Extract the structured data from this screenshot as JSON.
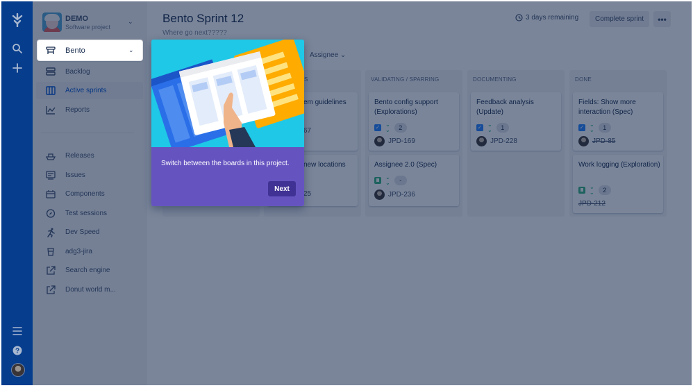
{
  "project": {
    "name": "DEMO",
    "type": "Software project"
  },
  "board_switcher": {
    "label": "Bento"
  },
  "nav": {
    "primary": [
      {
        "label": "Backlog",
        "icon": "backlog-icon",
        "active": false
      },
      {
        "label": "Active sprints",
        "icon": "board-icon",
        "active": true
      },
      {
        "label": "Reports",
        "icon": "reports-icon",
        "active": false
      }
    ],
    "secondary": [
      {
        "label": "Releases",
        "icon": "ship-icon"
      },
      {
        "label": "Issues",
        "icon": "issues-icon"
      },
      {
        "label": "Components",
        "icon": "components-icon"
      },
      {
        "label": "Test sessions",
        "icon": "compass-icon"
      },
      {
        "label": "Dev Speed",
        "icon": "runner-icon"
      },
      {
        "label": "adg3-jira",
        "icon": "bucket-icon"
      },
      {
        "label": "Search engine",
        "icon": "external-link-icon"
      },
      {
        "label": "Donut world m...",
        "icon": "external-link-icon"
      }
    ]
  },
  "header": {
    "title": "Bento Sprint 12",
    "subtitle": "Where go next?????",
    "remaining": "3 days remaining",
    "complete_label": "Complete sprint",
    "more_label": "•••"
  },
  "filters": {
    "assignee_label": "Assignee"
  },
  "columns": [
    {
      "name": "",
      "cards": []
    },
    {
      "name": "S",
      "cards": [
        {
          "title": "em guidelines",
          "key": "67"
        },
        {
          "title": "new locations",
          "key": "25"
        }
      ]
    },
    {
      "name": "VALIDATING / SPARRING",
      "cards": [
        {
          "title": "Bento config support (Explorations)",
          "type": "task",
          "estimate": "2",
          "key": "JPD-169",
          "done": false
        },
        {
          "title": "Assignee 2.0 (Spec)",
          "type": "story",
          "estimate": "-",
          "key": "JPD-236",
          "done": false
        }
      ]
    },
    {
      "name": "DOCUMENTING",
      "cards": [
        {
          "title": "Feedback analysis (Update)",
          "type": "task",
          "estimate": "1",
          "key": "JPD-228",
          "done": false
        }
      ]
    },
    {
      "name": "DONE",
      "cards": [
        {
          "title": "Fields: Show more interaction (Spec)",
          "type": "task",
          "estimate": "1",
          "key": "JPD-85",
          "done": true
        },
        {
          "title": "Work logging (Exploration)",
          "type": "story",
          "estimate": "2",
          "key": "JPD-212",
          "done": true
        }
      ]
    }
  ],
  "spotlight": {
    "message": "Switch between the boards in this project.",
    "next_label": "Next"
  },
  "colors": {
    "global_nav": "#0747a6",
    "sidebar": "#f4f5f7",
    "spotlight_body": "#6554c0",
    "spotlight_button": "#403294",
    "spotlight_hero": "#1fc8e6"
  }
}
